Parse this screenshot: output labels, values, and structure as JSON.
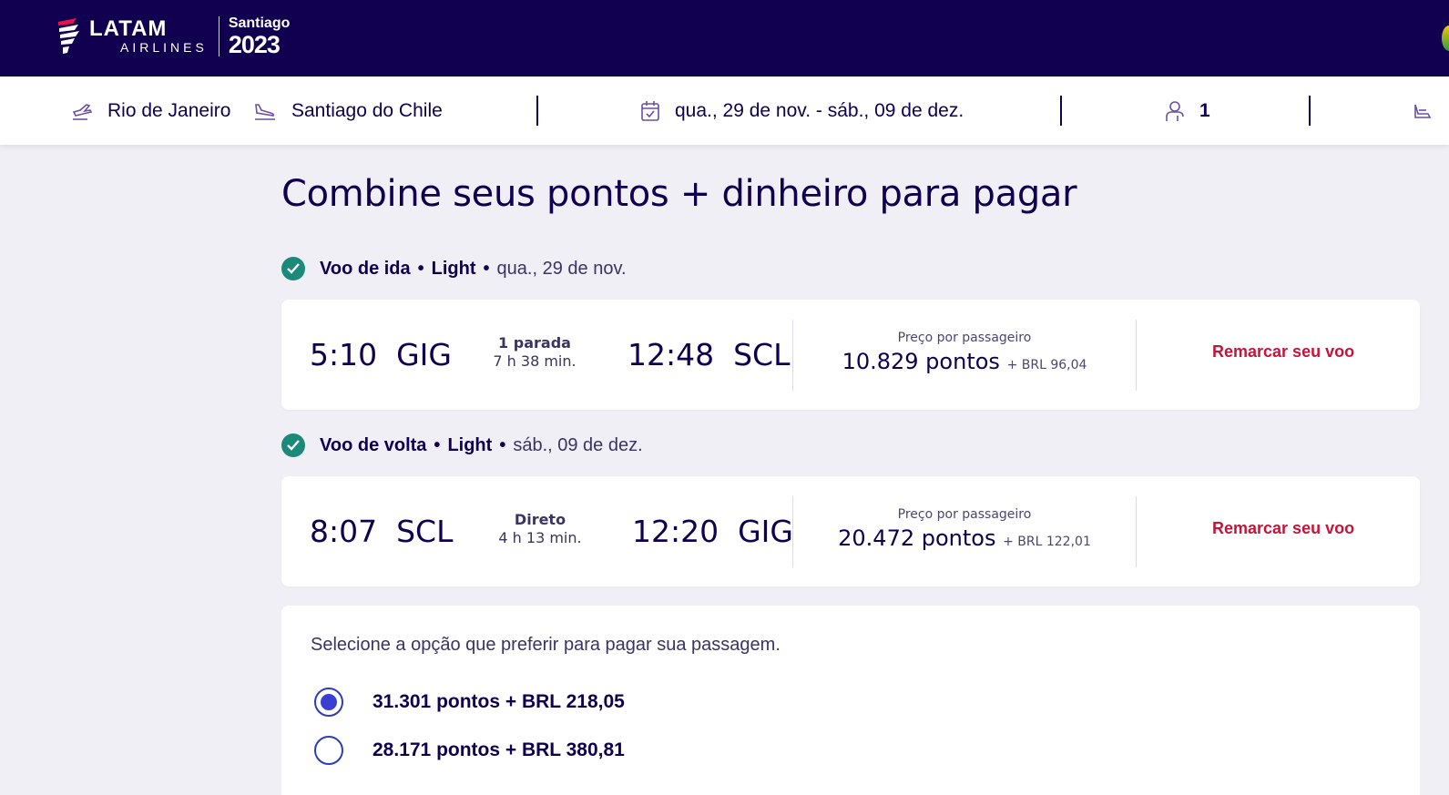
{
  "header": {
    "brand_name": "LATAM",
    "brand_sub": "AIRLINES",
    "event_city": "Santiago",
    "event_year": "2023",
    "colors": {
      "navy": "#10004f",
      "accent_red": "#c1153a",
      "success": "#1b8a7a",
      "radio_blue": "#3a3fd4"
    }
  },
  "search": {
    "origin": "Rio de Janeiro",
    "destination": "Santiago do Chile",
    "dates": "qua., 29 de nov. - sáb., 09 de dez.",
    "passengers": "1",
    "icons": [
      "takeoff-icon",
      "landing-icon",
      "calendar-icon",
      "person-icon",
      "seat-icon"
    ]
  },
  "main": {
    "title": "Combine seus pontos + dinheiro para pagar",
    "outbound": {
      "leg_label": "Voo de ida",
      "fare": "Light",
      "date": "qua., 29 de nov.",
      "dep_time": "5:10",
      "dep_airport": "GIG",
      "stops": "1 parada",
      "duration": "7 h 38 min.",
      "arr_time": "12:48",
      "arr_airport": "SCL",
      "price_label": "Preço por passageiro",
      "price_points": "10.829 pontos",
      "price_cash": "+ BRL 96,04",
      "rebook": "Remarcar seu voo"
    },
    "inbound": {
      "leg_label": "Voo de volta",
      "fare": "Light",
      "date": "sáb., 09 de dez.",
      "dep_time": "8:07",
      "dep_airport": "SCL",
      "stops": "Direto",
      "duration": "4 h 13 min.",
      "arr_time": "12:20",
      "arr_airport": "GIG",
      "price_label": "Preço por passageiro",
      "price_points": "20.472 pontos",
      "price_cash": "+ BRL 122,01",
      "rebook": "Remarcar seu voo"
    },
    "payment": {
      "question": "Selecione a opção que preferir para pagar sua passagem.",
      "options": [
        {
          "label": "31.301 pontos + BRL 218,05",
          "selected": true
        },
        {
          "label": "28.171 pontos + BRL 380,81",
          "selected": false
        }
      ]
    }
  }
}
